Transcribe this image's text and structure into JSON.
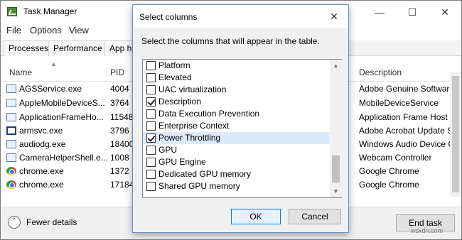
{
  "task_manager": {
    "title": "Task Manager",
    "window_buttons": {
      "minimize": "—",
      "maximize": "☐",
      "close": "✕"
    },
    "menu": [
      "File",
      "Options",
      "View"
    ],
    "tabs": [
      "Processes",
      "Performance",
      "App hi"
    ],
    "columns": {
      "name": "Name",
      "pid": "PID",
      "description": "Description"
    },
    "rows": [
      {
        "icon": "service-icon",
        "name": "AGSService.exe",
        "pid": "4004",
        "description": "Adobe Genuine Software"
      },
      {
        "icon": "app-icon",
        "name": "AppleMobileDeviceS...",
        "pid": "3764",
        "description": "MobileDeviceService"
      },
      {
        "icon": "app-icon",
        "name": "ApplicationFrameHo...",
        "pid": "11548",
        "description": "Application Frame Host"
      },
      {
        "icon": "window-icon",
        "name": "armsvc.exe",
        "pid": "3796",
        "description": "Adobe Acrobat Update S"
      },
      {
        "icon": "app-icon",
        "name": "audiodg.exe",
        "pid": "18400",
        "description": "Windows Audio Device G"
      },
      {
        "icon": "app-icon",
        "name": "CameraHelperShell.e...",
        "pid": "1008",
        "description": "Webcam Controller"
      },
      {
        "icon": "chrome-icon",
        "name": "chrome.exe",
        "pid": "1372",
        "description": "Google Chrome"
      },
      {
        "icon": "chrome-icon",
        "name": "chrome.exe",
        "pid": "17184",
        "description": "Google Chrome"
      }
    ],
    "footer": {
      "fewer_details": "Fewer details",
      "end_task": "End task"
    }
  },
  "dialog": {
    "title": "Select columns",
    "close": "✕",
    "instruction": "Select the columns that will appear in the table.",
    "options": [
      {
        "label": "Platform",
        "checked": false,
        "selected": false
      },
      {
        "label": "Elevated",
        "checked": false,
        "selected": false
      },
      {
        "label": "UAC virtualization",
        "checked": false,
        "selected": false
      },
      {
        "label": "Description",
        "checked": true,
        "selected": false
      },
      {
        "label": "Data Execution Prevention",
        "checked": false,
        "selected": false
      },
      {
        "label": "Enterprise Context",
        "checked": false,
        "selected": false
      },
      {
        "label": "Power Throttling",
        "checked": true,
        "selected": true
      },
      {
        "label": "GPU",
        "checked": false,
        "selected": false
      },
      {
        "label": "GPU Engine",
        "checked": false,
        "selected": false
      },
      {
        "label": "Dedicated GPU memory",
        "checked": false,
        "selected": false
      },
      {
        "label": "Shared GPU memory",
        "checked": false,
        "selected": false
      }
    ],
    "ok": "OK",
    "cancel": "Cancel"
  },
  "watermark": "wsxdn.com"
}
